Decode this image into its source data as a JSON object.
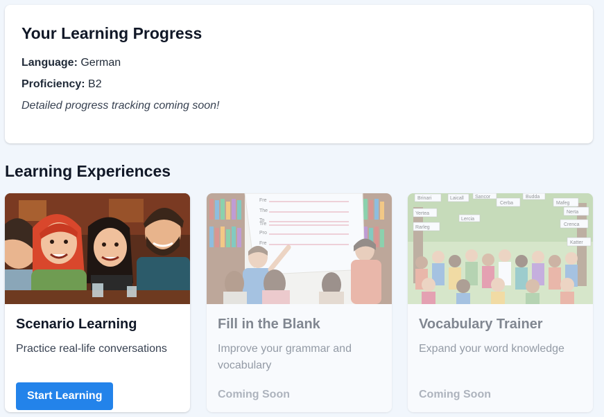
{
  "progress": {
    "title": "Your Learning Progress",
    "language_label": "Language:",
    "language_value": "German",
    "proficiency_label": "Proficiency:",
    "proficiency_value": "B2",
    "note": "Detailed progress tracking coming soon!"
  },
  "experiences": {
    "title": "Learning Experiences",
    "cards": [
      {
        "title": "Scenario Learning",
        "description": "Practice real-life conversations",
        "cta": "Start Learning",
        "image": "friends-conversation-illustration"
      },
      {
        "title": "Fill in the Blank",
        "description": "Improve your grammar and vocabulary",
        "status": "Coming Soon",
        "image": "classroom-fill-blank-illustration",
        "sheet_words": [
          "Fre",
          "The",
          "To",
          "Tre",
          "Pro",
          "Fre"
        ]
      },
      {
        "title": "Vocabulary Trainer",
        "description": "Expand your word knowledge",
        "status": "Coming Soon",
        "image": "crowd-vocabulary-words-illustration",
        "tags": [
          "Brinari",
          "Laicall",
          "Sancor",
          "Budda",
          "Yertea",
          "Cerba",
          "Mafeg",
          "Rarleg",
          "Lercia",
          "Nerta",
          "Crenca",
          "Katter"
        ]
      }
    ]
  },
  "colors": {
    "background": "#f1f6fc",
    "accent": "#2383ea"
  }
}
